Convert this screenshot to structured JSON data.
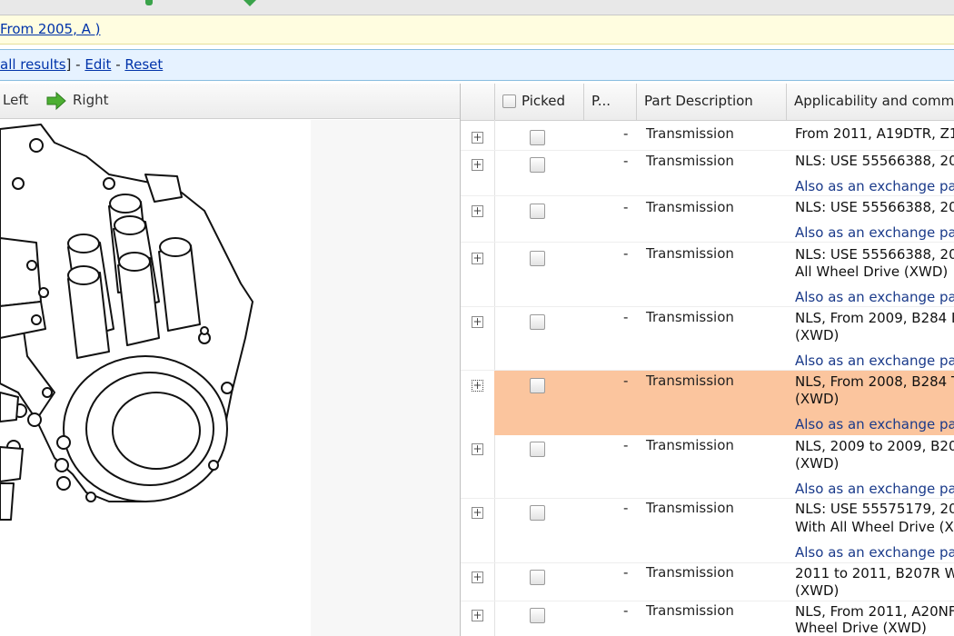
{
  "top": {
    "breadcrumb_link": "From 2005, A )"
  },
  "filterbar": {
    "all_results": "all results",
    "edit": "Edit",
    "reset": "Reset"
  },
  "viewer": {
    "left_label": "Left",
    "right_label": "Right"
  },
  "grid": {
    "columns": [
      "Picked",
      "P...",
      "Part Description",
      "Applicability and comme"
    ],
    "rows": [
      {
        "dash": "-",
        "desc": "Transmission",
        "app": "From 2011, A19DTR, Z1",
        "sub": ""
      },
      {
        "dash": "-",
        "desc": "Transmission",
        "app": "NLS: USE 55566388, 20",
        "sub": "Also as an exchange pa"
      },
      {
        "dash": "-",
        "desc": "Transmission",
        "app": "NLS: USE 55566388, 20",
        "sub": "Also as an exchange pa"
      },
      {
        "dash": "-",
        "desc": "Transmission",
        "app": "NLS: USE 55566388, 20",
        "app2": "All Wheel Drive (XWD)",
        "sub": "Also as an exchange pa"
      },
      {
        "dash": "-",
        "desc": "Transmission",
        "app": "NLS, From 2009, B284 I",
        "app2": "(XWD)",
        "sub": "Also as an exchange pa"
      },
      {
        "dash": "-",
        "desc": "Transmission",
        "app": "NLS, From 2008, B284 T",
        "app2": "(XWD)",
        "sub": "Also as an exchange pa"
      },
      {
        "dash": "-",
        "desc": "Transmission",
        "app": "NLS, 2009 to 2009, B20",
        "app2": "(XWD)",
        "sub": "Also as an exchange pa"
      },
      {
        "dash": "-",
        "desc": "Transmission",
        "app": "NLS: USE 55575179, 20",
        "app2": "With All Wheel Drive (XV",
        "sub": "Also as an exchange pa"
      },
      {
        "dash": "-",
        "desc": "Transmission",
        "app": "2011 to 2011, B207R W",
        "app2": "(XWD)",
        "sub": ""
      },
      {
        "dash": "-",
        "desc": "Transmission",
        "app": "NLS, From 2011, A20NF",
        "app2": "Wheel Drive (XWD)",
        "sub": ""
      }
    ]
  },
  "colors": {
    "selected_row": "#fbc59e",
    "link": "#0033aa",
    "filter_bar_bg": "#e6f2ff",
    "notice_bar_bg": "#fffde0"
  }
}
